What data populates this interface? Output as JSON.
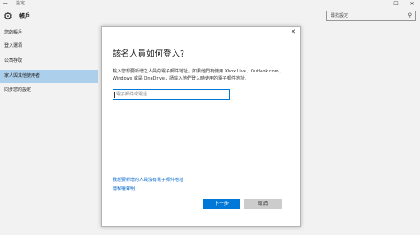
{
  "window": {
    "back_glyph": "←",
    "title": "設定",
    "minimize_glyph": "—",
    "maximize_glyph": "☐",
    "close_glyph": "✕"
  },
  "header": {
    "icon": "gear-icon",
    "title": "帳戶",
    "search_placeholder": "尋找設定",
    "search_icon": "search-icon"
  },
  "sidebar": {
    "items": [
      {
        "label": "您的帳戶"
      },
      {
        "label": "登入選項"
      },
      {
        "label": "公司存取"
      },
      {
        "label": "家人與其他使用者",
        "selected": true
      },
      {
        "label": "同步您的設定"
      }
    ]
  },
  "dialog": {
    "close_glyph": "✕",
    "title": "該名人員如何登入?",
    "description": "輸入您想要新增之人員的電子郵件地址。如果他們有使用 Xbox Live、Outlook.com、Windows 或是 OneDrive，請輸入他們登入時使用的電子郵件地址。",
    "input_placeholder": "電子郵件或電話",
    "link_no_email": "我想要新增的人員沒有電子郵件地址",
    "link_privacy": "隱私權聲明",
    "next_label": "下一步",
    "cancel_label": "取消"
  },
  "colors": {
    "accent": "#0078d7",
    "selected_nav": "#b6dcf8",
    "link": "#0066cc"
  }
}
